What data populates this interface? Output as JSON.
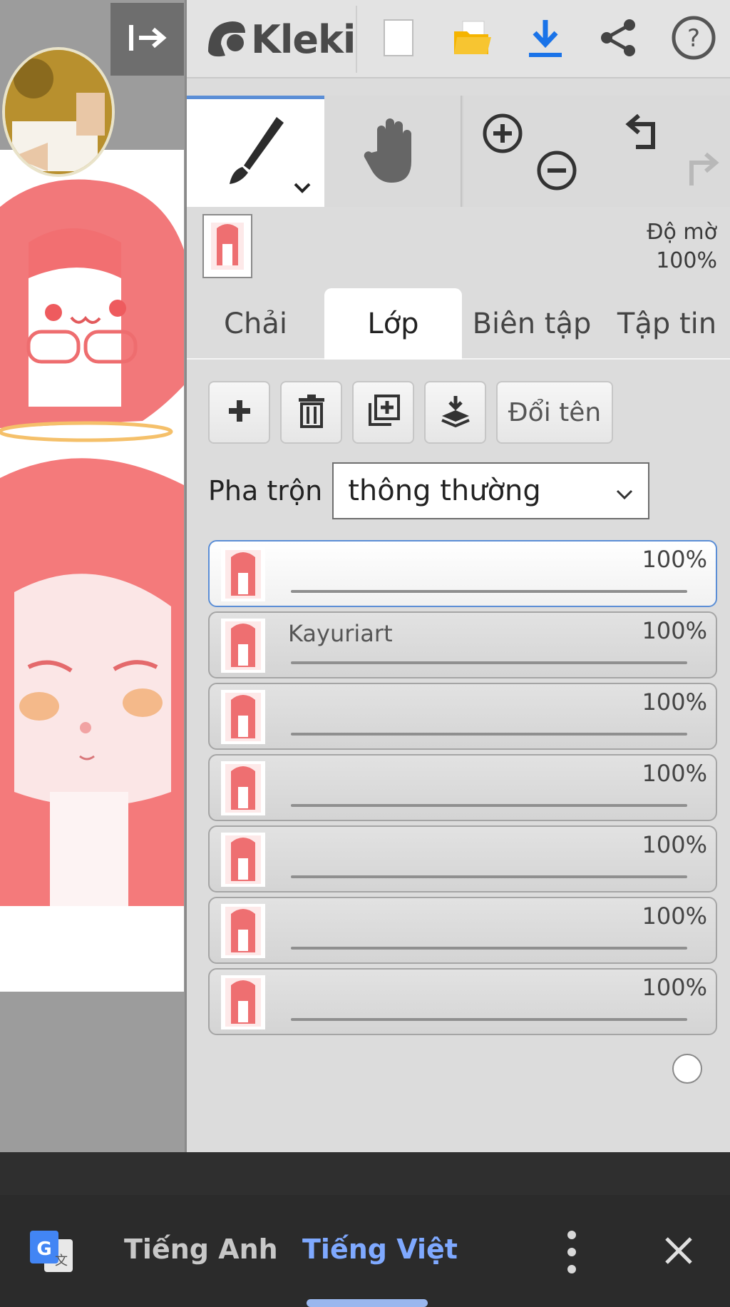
{
  "app": {
    "name": "Kleki"
  },
  "topbar": {
    "collapse_icon": "collapse-right-arrow-icon",
    "icons": [
      "new-file-icon",
      "open-folder-icon",
      "download-icon",
      "share-icon",
      "help-icon"
    ],
    "accent_color": "#1a73e8",
    "folder_color": "#f5b400"
  },
  "tools": {
    "brush": "brush-icon",
    "hand": "hand-icon",
    "zoom_in": "zoom-in-icon",
    "zoom_out": "zoom-out-icon",
    "undo": "undo-icon",
    "redo": "redo-icon"
  },
  "opacity": {
    "label": "Độ mờ",
    "value": "100%"
  },
  "tabs": [
    {
      "label": "Chải",
      "active": false
    },
    {
      "label": "Lớp",
      "active": true
    },
    {
      "label": "Biên tập",
      "active": false
    },
    {
      "label": "Tập tin",
      "active": false
    }
  ],
  "layer_actions": {
    "rename_label": "Đổi tên"
  },
  "blend": {
    "label": "Pha trộn",
    "value": "thông thường"
  },
  "layers": [
    {
      "name": "",
      "opacity_label": "100%",
      "opacity": 1.0,
      "selected": true
    },
    {
      "name": "Kayuriart",
      "opacity_label": "100%",
      "opacity": 1.0,
      "selected": false
    },
    {
      "name": "",
      "opacity_label": "100%",
      "opacity": 1.0,
      "selected": false
    },
    {
      "name": "",
      "opacity_label": "100%",
      "opacity": 1.0,
      "selected": false
    },
    {
      "name": "",
      "opacity_label": "100%",
      "opacity": 1.0,
      "selected": false
    },
    {
      "name": "",
      "opacity_label": "100%",
      "opacity": 1.0,
      "selected": false
    },
    {
      "name": "",
      "opacity_label": "100%",
      "opacity": 1.0,
      "selected": false
    }
  ],
  "translate_bar": {
    "source_lang": "Tiếng Anh",
    "target_lang": "Tiếng Việt",
    "active_color": "#7fa9ff"
  }
}
